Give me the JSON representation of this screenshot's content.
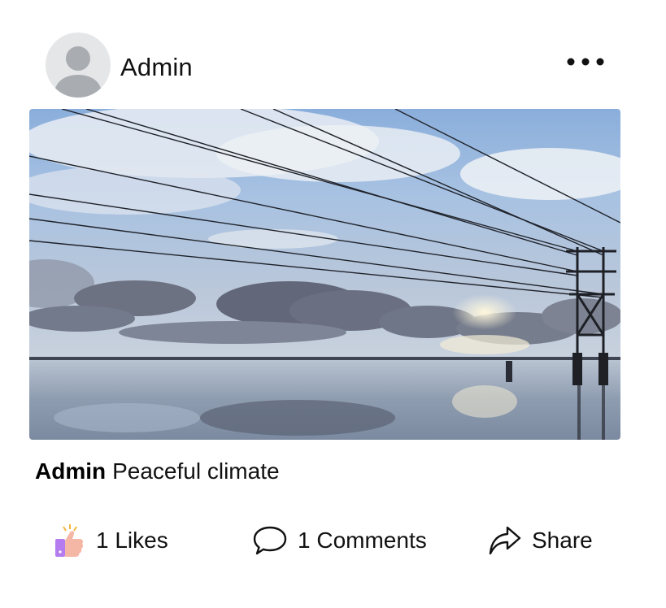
{
  "post": {
    "author": "Admin",
    "caption_author": "Admin",
    "caption_text": "Peaceful climate",
    "image": "landscape photo: cloudy sky over flooded field with power lines and pole"
  },
  "actions": {
    "likes_label": "1 Likes",
    "comments_label": "1 Comments",
    "share_label": "Share"
  },
  "icons": {
    "menu": "more-horizontal-icon",
    "like": "thumbs-up-icon",
    "comment": "speech-bubble-icon",
    "share": "share-arrow-icon",
    "avatar": "default-user-icon"
  },
  "colors": {
    "avatar_bg": "#e4e6e8",
    "avatar_fg": "#a9adb1",
    "like_accent": "#b57cf0",
    "like_hand": "#f5b7a5"
  }
}
